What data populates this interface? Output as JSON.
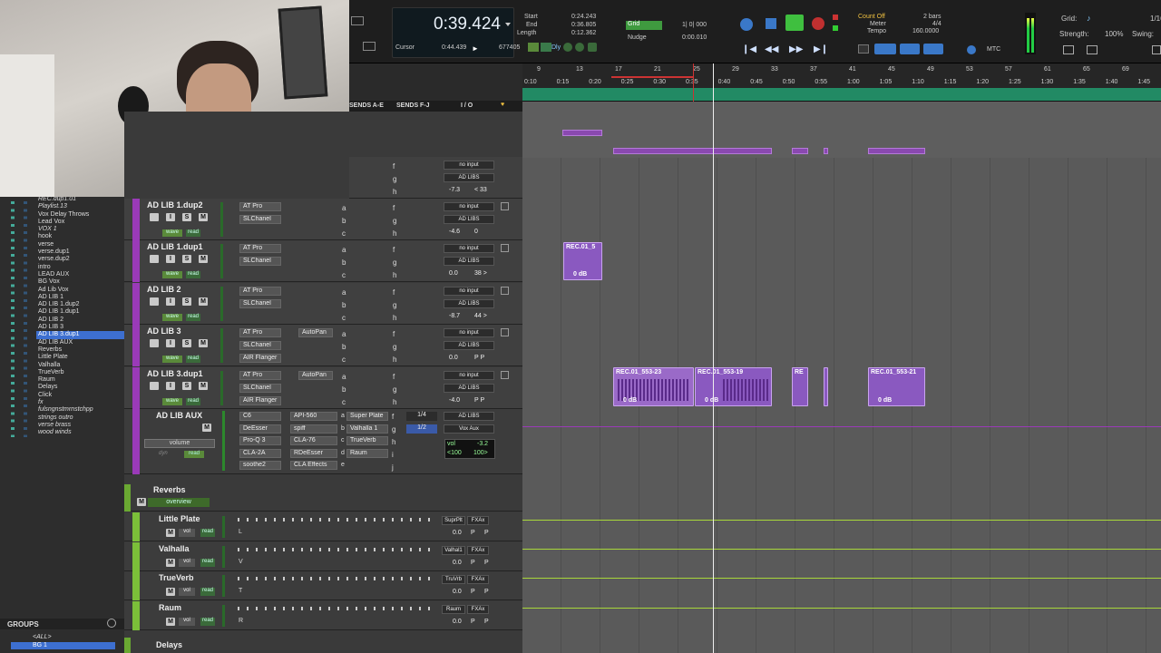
{
  "transport": {
    "main_counter": "0:39.424",
    "cursor_label": "Cursor",
    "cursor_value": "0:44.439",
    "sample": "677405",
    "start_label": "Start",
    "start_value": "0:24.243",
    "end_label": "End",
    "end_value": "0:36.805",
    "length_label": "Length",
    "length_value": "0:12.362",
    "dly_label": "Dly",
    "grid_label": "Grid",
    "grid_value": "1| 0| 000",
    "nudge_label": "Nudge",
    "nudge_value": "0:00.010",
    "count_off": "Count Off",
    "meter_label": "Meter",
    "meter_value": "4/4",
    "tempo_label": "Tempo",
    "tempo_value": "160.0000",
    "bars_value": "2 bars",
    "mtc_label": "MTC",
    "grid_right_label": "Grid:",
    "strength_label": "Strength:",
    "strength_value": "100%",
    "swing_label": "Swing:",
    "grid_right_value": "1/16"
  },
  "columns": {
    "sends_ae": "SENDS A-E",
    "sends_fj": "SENDS F-J",
    "io": "I / O"
  },
  "ruler": {
    "bars": [
      "9",
      "13",
      "17",
      "21",
      "25",
      "29",
      "33",
      "37",
      "41",
      "45",
      "49",
      "53",
      "57",
      "61",
      "65",
      "69"
    ],
    "times": [
      "0:10",
      "0:15",
      "0:20",
      "0:25",
      "0:30",
      "0:35",
      "0:40",
      "0:45",
      "0:50",
      "0:55",
      "1:00",
      "1:05",
      "1:10",
      "1:15",
      "1:20",
      "1:25",
      "1:30",
      "1:35",
      "1:40",
      "1:45"
    ]
  },
  "tracklist": [
    "REC.dup1.01",
    "Playlist.13",
    "Vox Delay Throws",
    "Lead Vox",
    "VOX 1",
    "hook",
    "verse",
    "verse.dup1",
    "verse.dup2",
    "intro",
    "LEAD AUX",
    "BG Vox",
    "Ad Lib Vox",
    "AD LIB 1",
    "AD LIB 1.dup2",
    "AD LIB 1.dup1",
    "AD LIB 2",
    "AD LIB 3",
    "AD LIB 3.dup1",
    "AD LIB AUX",
    "Reverbs",
    "Little Plate",
    "Valhalla",
    "TrueVerb",
    "Raum",
    "Delays",
    "Click",
    "fx",
    "fulsngnstmrnstchpp",
    "strings outro",
    "verse brass",
    "wood winds"
  ],
  "groups": {
    "title": "GROUPS",
    "items": [
      "<ALL>",
      "BG 1"
    ]
  },
  "top_row": {
    "io_in": "no input",
    "io_out": "AD LIBS",
    "vol": "-7.3",
    "pan": "< 33",
    "sends": [
      "f",
      "g",
      "h"
    ]
  },
  "tracks": [
    {
      "name": "AD LIB 1.dup2",
      "ins": [
        "AT Pro",
        "SLChanel"
      ],
      "ins2": [
        "",
        ""
      ],
      "ins3": "",
      "sends": [
        "a",
        "b",
        "c"
      ],
      "sends2": [
        "f",
        "g",
        "h"
      ],
      "io_in": "no input",
      "io_out": "AD LIBS",
      "vol": "-4.6",
      "pan": "0",
      "auto": "wave",
      "read": "read"
    },
    {
      "name": "AD LIB 1.dup1",
      "ins": [
        "AT Pro",
        "SLChanel"
      ],
      "ins2": [
        "",
        ""
      ],
      "ins3": "",
      "sends": [
        "a",
        "b",
        "c"
      ],
      "sends2": [
        "f",
        "g",
        "h"
      ],
      "io_in": "no input",
      "io_out": "AD LIBS",
      "vol": "0.0",
      "pan": "38 >",
      "auto": "wave",
      "read": "read"
    },
    {
      "name": "AD LIB 2",
      "ins": [
        "AT Pro",
        "SLChanel"
      ],
      "ins2": [
        "",
        ""
      ],
      "ins3": "",
      "sends": [
        "a",
        "b",
        "c"
      ],
      "sends2": [
        "f",
        "g",
        "h"
      ],
      "io_in": "no input",
      "io_out": "AD LIBS",
      "vol": "-8.7",
      "pan": "44 >",
      "auto": "wave",
      "read": "read"
    },
    {
      "name": "AD LIB 3",
      "ins": [
        "AT Pro",
        "SLChanel"
      ],
      "ins2": [
        "AutoPan",
        ""
      ],
      "ins3": "AIR Flanger",
      "sends": [
        "a",
        "b",
        "c"
      ],
      "sends2": [
        "f",
        "g",
        "h"
      ],
      "io_in": "no input",
      "io_out": "AD LIBS",
      "vol": "0.0",
      "pan": "P P",
      "auto": "wave",
      "read": "read"
    },
    {
      "name": "AD LIB 3.dup1",
      "ins": [
        "AT Pro",
        "SLChanel"
      ],
      "ins2": [
        "AutoPan",
        ""
      ],
      "ins3": "AIR Flanger",
      "sends": [
        "a",
        "b",
        "c"
      ],
      "sends2": [
        "f",
        "g",
        "h"
      ],
      "io_in": "no input",
      "io_out": "AD LIBS",
      "vol": "-4.0",
      "pan": "P P",
      "auto": "wave",
      "read": "read"
    }
  ],
  "aux": {
    "name": "AD LIB AUX",
    "mode": "volume",
    "dyn": "dyn",
    "read": "read",
    "ins_a": [
      "C6",
      "DeEsser",
      "Pro-Q 3",
      "CLA-2A",
      "soothe2"
    ],
    "ins_b": [
      "API-560",
      "spiff",
      "CLA-76",
      "RDeEsser",
      "CLA Effects"
    ],
    "sends_a": [
      "Super Plate",
      "Valhalla 1",
      "TrueVerb",
      "Raum"
    ],
    "send_letters": [
      "a",
      "b",
      "c",
      "d",
      "e"
    ],
    "send_f": "f",
    "send_g": "g",
    "send_h": "h",
    "send_i": "i",
    "send_j": "j",
    "frac1": "1/4",
    "frac2": "1/2",
    "io_in": "AD LIBS",
    "io_out": "Vox Aux",
    "vol_label": "vol",
    "vol": "-3.2",
    "pan_l": "<100",
    "pan_r": "100>"
  },
  "folder_reverbs": {
    "name": "Reverbs",
    "view": "overview",
    "m": "M"
  },
  "reverb_tracks": [
    {
      "name": "Little Plate",
      "io": "SuprPlt",
      "out": "FXAx",
      "vol": "0.0",
      "p": "P",
      "p2": "P",
      "letter": "L"
    },
    {
      "name": "Valhalla",
      "io": "Valhal1",
      "out": "FXAx",
      "vol": "0.0",
      "p": "P",
      "p2": "P",
      "letter": "V"
    },
    {
      "name": "TrueVerb",
      "io": "TruVrb",
      "out": "FXAx",
      "vol": "0.0",
      "p": "P",
      "p2": "P",
      "letter": "T"
    },
    {
      "name": "Raum",
      "io": "Raum",
      "out": "FXAx",
      "vol": "0.0",
      "p": "P",
      "p2": "P",
      "letter": "R"
    }
  ],
  "folder_delays": {
    "name": "Delays"
  },
  "clips": [
    {
      "label": "REC.01_5"
    },
    {
      "label": "REC.01_553-23"
    },
    {
      "label": "REC.01_553-19"
    },
    {
      "label": "RE"
    },
    {
      "label": "REC.01_553-21"
    }
  ],
  "clip_gain": "0 dB",
  "colors": {
    "adlib": "#9a3ab8",
    "reverb": "#7bbf39",
    "clip": "#8a59c0",
    "ruler_bar": "#228a64"
  }
}
